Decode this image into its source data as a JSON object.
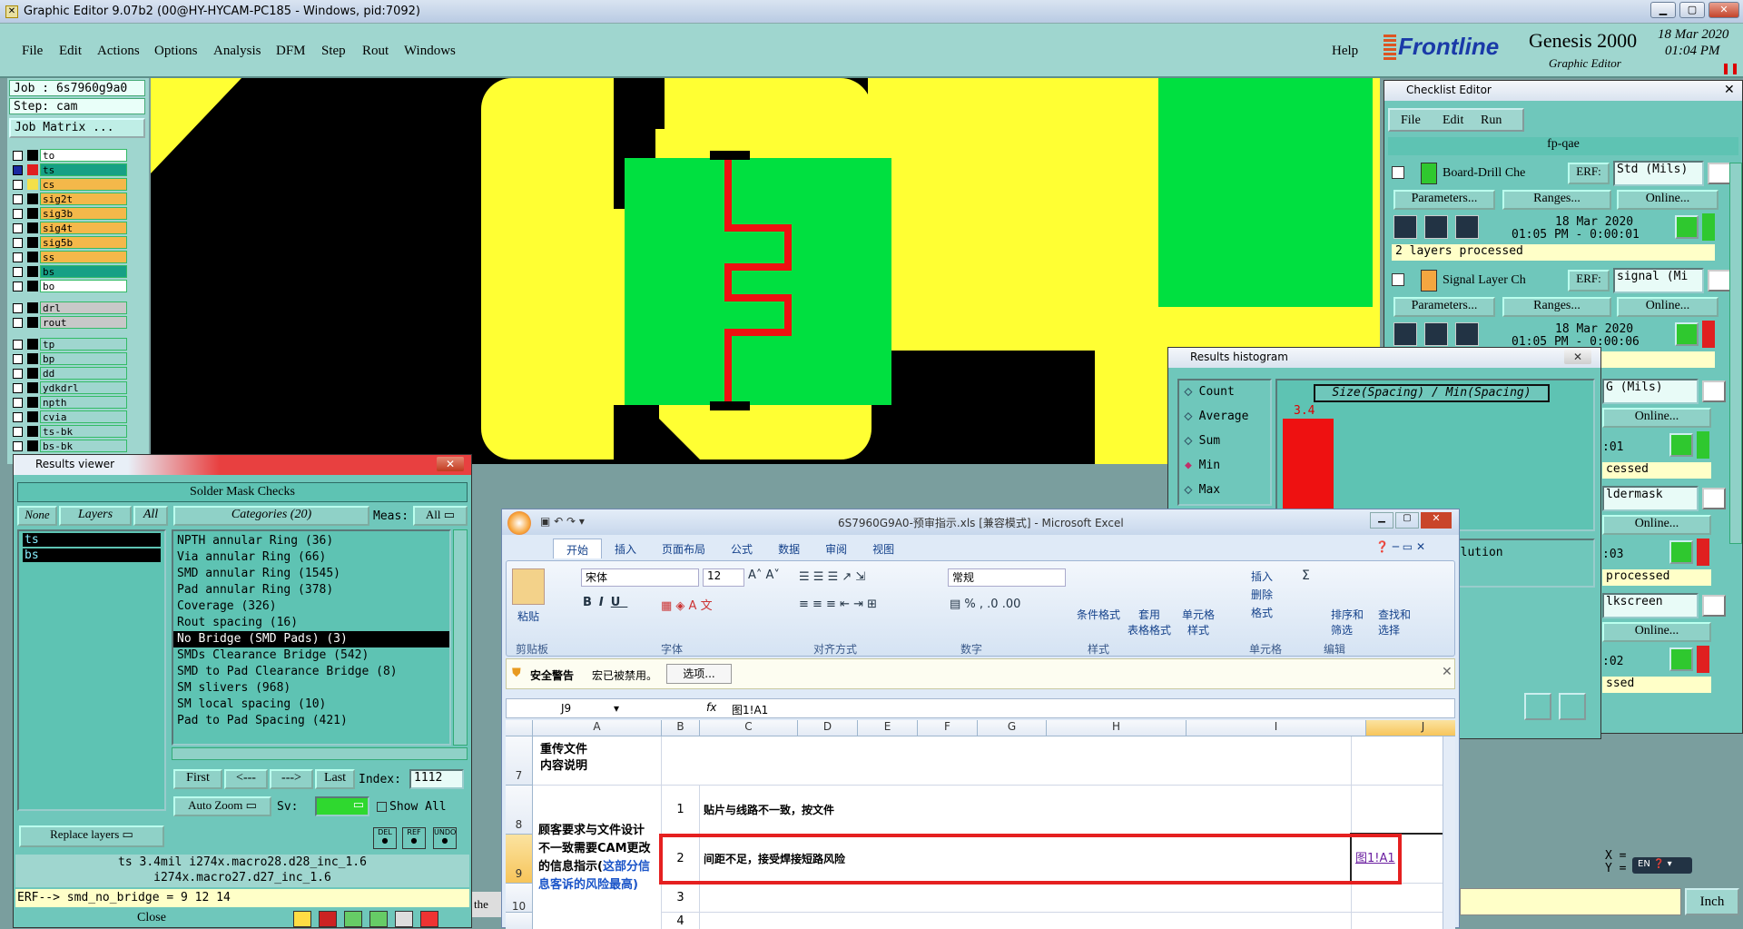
{
  "window": {
    "title": "Graphic Editor 9.07b2 (00@HY-HYCAM-PC185 - Windows, pid:7092)"
  },
  "menu": {
    "items": [
      "File",
      "Edit",
      "Actions",
      "Options",
      "Analysis",
      "DFM",
      "Step",
      "Rout",
      "Windows"
    ],
    "help": "Help"
  },
  "brand": {
    "logo": "Frontline",
    "product": "Genesis 2000",
    "subtitle": "Graphic Editor",
    "date": "18 Mar 2020",
    "time": "01:04 PM"
  },
  "job": {
    "job_label": "Job : 6s7960g9a0",
    "step_label": "Step: cam",
    "matrix_button": "Job Matrix ..."
  },
  "layers": [
    {
      "name": "to",
      "color": "#ffffff",
      "swatch": "#000000",
      "checked": false
    },
    {
      "name": "ts",
      "color": "#16a085",
      "swatch": "#e02020",
      "checked": true
    },
    {
      "name": "cs",
      "color": "#f4b84a",
      "swatch": "#f4e04a",
      "checked": false
    },
    {
      "name": "sig2t",
      "color": "#f4b84a",
      "swatch": "#000000",
      "checked": false
    },
    {
      "name": "sig3b",
      "color": "#f4b84a",
      "swatch": "#000000",
      "checked": false
    },
    {
      "name": "sig4t",
      "color": "#f4b84a",
      "swatch": "#000000",
      "checked": false
    },
    {
      "name": "sig5b",
      "color": "#f4b84a",
      "swatch": "#000000",
      "checked": false
    },
    {
      "name": "ss",
      "color": "#f4b84a",
      "swatch": "#000000",
      "checked": false
    },
    {
      "name": "bs",
      "color": "#16a085",
      "swatch": "#000000",
      "checked": false
    },
    {
      "name": "bo",
      "color": "#ffffff",
      "swatch": "#000000",
      "checked": false
    }
  ],
  "layers_drill": [
    {
      "name": "drl",
      "color": "#c8c8c8"
    },
    {
      "name": "rout",
      "color": "#c8c8c8"
    }
  ],
  "layers_misc": [
    {
      "name": "tp"
    },
    {
      "name": "bp"
    },
    {
      "name": "dd"
    },
    {
      "name": "ydkdrl"
    },
    {
      "name": "npth"
    },
    {
      "name": "cvia"
    },
    {
      "name": "ts-bk"
    },
    {
      "name": "bs-bk"
    }
  ],
  "results_viewer": {
    "title": "Results viewer",
    "header": "Solder Mask Checks",
    "none_label": "None",
    "layers_label": "Layers",
    "all_label": "All",
    "categories_label": "Categories (20)",
    "meas_label": "Meas:",
    "meas_value": "All",
    "layers": [
      "ts",
      "bs"
    ],
    "categories": [
      "NPTH annular Ring (36)",
      "Via annular Ring (66)",
      "SMD annular Ring (1545)",
      "Pad annular Ring (378)",
      "Coverage (326)",
      "Rout spacing (16)",
      "No Bridge (SMD Pads) (3)",
      "SMDs Clearance Bridge (542)",
      "SMD to Pad Clearance Bridge (8)",
      "SM slivers (968)",
      "SM local spacing (10)",
      "Pad to Pad Spacing (421)"
    ],
    "selected_index": 6,
    "nav": {
      "first": "First",
      "prev": "<---",
      "next": "--->",
      "last": "Last",
      "index_label": "Index:",
      "index_value": "1112"
    },
    "auto_zoom": "Auto Zoom",
    "sv_label": "Sv:",
    "show_all": "Show All",
    "replace_layers": "Replace layers",
    "icon_labels": {
      "del": "DEL",
      "ref": "REF",
      "undo": "UNDO"
    },
    "status_line1": "ts 3.4mil  i274x.macro28.d28_inc_1.6",
    "status_line2": "i274x.macro27.d27_inc_1.6",
    "erf_line": "ERF--> smd_no_bridge = 9 12 14",
    "close": "Close"
  },
  "checklist": {
    "title": "Checklist Editor",
    "menu": [
      "File",
      "Edit",
      "Run"
    ],
    "name": "fp-qae",
    "rows": [
      {
        "label": "Board-Drill Che",
        "erf_label": "ERF:",
        "erf_value": "Std (Mils)",
        "date": "18 Mar 2020",
        "time": "01:05 PM - 0:00:01",
        "status": "2 layers processed",
        "status_color": "#2fc82f"
      },
      {
        "label": "Signal Layer Ch",
        "erf_label": "ERF:",
        "erf_value": "signal (Mi",
        "date": "18 Mar 2020",
        "time": "01:05 PM - 0:00:06",
        "status": "",
        "status_color": "#e02020"
      }
    ],
    "params_label": "Parameters...",
    "ranges_label": "Ranges...",
    "online_label": "Online...",
    "partial": [
      {
        "erf_value": "G (Mils)",
        "time": ":01",
        "status": "cessed",
        "color": "#2fc82f"
      },
      {
        "erf_value": "ldermask",
        "time": ":03",
        "status": "processed",
        "color": "#e02020"
      },
      {
        "erf_value": "lkscreen",
        "time": ":02",
        "status": "ssed",
        "color": "#e02020"
      }
    ]
  },
  "histogram": {
    "title": "Results histogram",
    "options": [
      "Count",
      "Average",
      "Sum",
      "Min",
      "Max"
    ],
    "selected": "Min",
    "graph_title": "Size(Spacing) / Min(Spacing)",
    "bar_label": "3.4",
    "resolution_label": "solution"
  },
  "excel": {
    "title": "6S7960G9A0-预审指示.xls [兼容模式] - Microsoft Excel",
    "tabs": [
      "开始",
      "插入",
      "页面布局",
      "公式",
      "数据",
      "审阅",
      "视图"
    ],
    "groups": [
      "剪贴板",
      "字体",
      "对齐方式",
      "数字",
      "样式",
      "单元格",
      "编辑"
    ],
    "paste": "粘贴",
    "font_name": "宋体",
    "font_size": "12",
    "number_format": "常规",
    "style_buttons": [
      "条件格式",
      "套用\n表格格式",
      "单元格\n样式"
    ],
    "cell_buttons": [
      "插入",
      "删除",
      "格式"
    ],
    "edit_buttons": [
      "排序和\n筛选",
      "查找和\n选择"
    ],
    "security_label": "安全警告",
    "security_msg": "宏已被禁用。",
    "security_button": "选项...",
    "name_box": "J9",
    "formula": "图1!A1",
    "columns": [
      "A",
      "B",
      "C",
      "D",
      "E",
      "F",
      "G",
      "H",
      "I",
      "J"
    ],
    "row7_label": "重传文件\n内容说明",
    "rowA_label": "顾客要求与文件设计不一致需要CAM更改的信息指示(",
    "rowA_blue": "这部分信息客诉的风险最高)",
    "rows": [
      {
        "num": "7"
      },
      {
        "num": "8",
        "b": "1",
        "text": "贴片与线路不一致，按文件"
      },
      {
        "num": "9",
        "b": "2",
        "text": "间距不足，接受焊接短路风险",
        "link": "图1!A1"
      },
      {
        "num": "10",
        "b": "3",
        "text": ""
      },
      {
        "num": "",
        "b": "4",
        "text": ""
      }
    ]
  },
  "bottom": {
    "the": "the",
    "unit": "Inch",
    "x_label": "X =",
    "y_label": "Y =",
    "ime": "EN"
  }
}
